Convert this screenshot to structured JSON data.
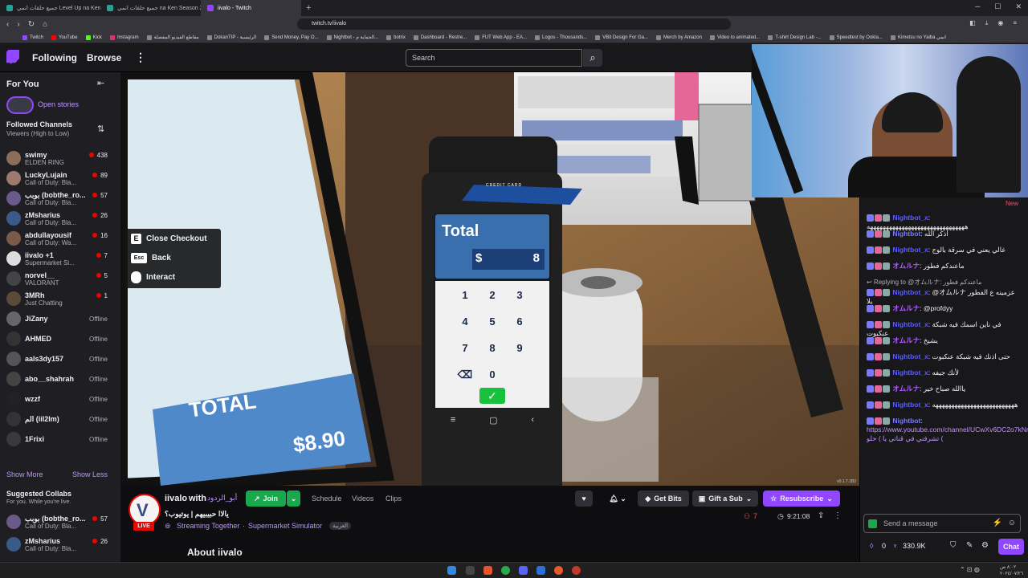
{
  "browser": {
    "tabs": [
      {
        "title": "جميع حلقات انمي Level Up na Ken",
        "color": "#2aa198"
      },
      {
        "title": "جميع حلقات انمي na Ken Season 2",
        "color": "#2aa198"
      },
      {
        "title": "iivalo - Twitch",
        "color": "#9147ff",
        "active": true
      }
    ],
    "url": "twitch.tv/iivalo",
    "bookmarks": [
      "Twitch",
      "YouTube",
      "Kick",
      "Instagram",
      "مقاطع الفيديو المفضلة",
      "DokanTIP - الرئيسية",
      "Send Money, Pay O...",
      "Nightbot - الحماية م...",
      "botrix",
      "Dashboard - Restre...",
      "FUT Web App - EA...",
      "Logos - Thousands...",
      "VBit Design For Ga...",
      "Merch by Amazon",
      "Video to animated...",
      "T-shirt Design Lab -...",
      "Speedtest by Ookla...",
      "Kimetsu no Yaiba انمي"
    ]
  },
  "topnav": {
    "following": "Following",
    "browse": "Browse",
    "search_placeholder": "Search"
  },
  "sidebar": {
    "for_you": "For You",
    "open_stories": "Open stories",
    "followed_title": "Followed Channels",
    "followed_sub": "Viewers (High to Low)",
    "channels": [
      {
        "name": "swimy",
        "game": "ELDEN RING",
        "viewers": "438",
        "live": true,
        "color": "#8a6d5a"
      },
      {
        "name": "LuckyLujain",
        "game": "Call of Duty: Bla...",
        "viewers": "89",
        "live": true,
        "color": "#9b7b6b"
      },
      {
        "name": "بوبب (bobthe_ro...",
        "game": "Call of Duty: Bla...",
        "viewers": "57",
        "live": true,
        "color": "#6a5a8a"
      },
      {
        "name": "zMsharius",
        "game": "Call of Duty: Bla...",
        "viewers": "26",
        "live": true,
        "color": "#3a5a8a"
      },
      {
        "name": "abdullayousif",
        "game": "Call of Duty: Wa...",
        "viewers": "16",
        "live": true,
        "color": "#7a5a4a"
      },
      {
        "name": "iivalo +1",
        "game": "Supermarket Si...",
        "viewers": "7",
        "live": true,
        "color": "#ddd"
      },
      {
        "name": "norvel__",
        "game": "VALORANT",
        "viewers": "5",
        "live": true,
        "color": "#444"
      },
      {
        "name": "3MRh",
        "game": "Just Chatting",
        "viewers": "1",
        "live": true,
        "color": "#5a4a3a"
      },
      {
        "name": "JiZany",
        "status": "Offline",
        "color": "#666"
      },
      {
        "name": "AHMED",
        "status": "Offline",
        "color": "#333"
      },
      {
        "name": "aals3dy157",
        "status": "Offline",
        "color": "#555"
      },
      {
        "name": "abo__shahrah",
        "status": "Offline",
        "color": "#444"
      },
      {
        "name": "wzzf",
        "status": "Offline",
        "color": "#222"
      },
      {
        "name": "الم (iil2lm)",
        "status": "Offline",
        "color": "#333"
      },
      {
        "name": "1Frixi",
        "status": "Offline",
        "color": "#3a3a3a"
      }
    ],
    "show_more": "Show More",
    "show_less": "Show Less",
    "suggested_title": "Suggested Collabs",
    "suggested_sub": "For you. While you're live.",
    "suggested": [
      {
        "name": "بوبب (bobthe_ro...",
        "game": "Call of Duty: Bla...",
        "viewers": "57",
        "color": "#6a5a8a"
      },
      {
        "name": "zMsharius",
        "game": "Call of Duty: Bla...",
        "viewers": "26",
        "color": "#3a5a8a"
      }
    ]
  },
  "game": {
    "prompts": [
      {
        "key": "E",
        "label": "Close Checkout"
      },
      {
        "key": "Esc",
        "label": "Back"
      },
      {
        "key": "",
        "label": "Interact"
      }
    ],
    "terminal_title": "Total",
    "terminal_currency": "$",
    "terminal_value": "8",
    "keypad": [
      "1",
      "2",
      "3",
      "4",
      "5",
      "6",
      "7",
      "8",
      "9",
      "⌫",
      "0",
      ""
    ],
    "card_label": "CREDIT CARD",
    "screen_total_label": "TOTAL",
    "screen_total_value": "$8.90",
    "version": "v0.1.7.1B2"
  },
  "stream": {
    "channel": "iivalo",
    "with_text": "with",
    "collab": "أبو_الردود",
    "title": "يالاا حبيبيهم | يوتيوب؟",
    "category_prefix": "Streaming Together",
    "category": "Supermarket Simulator",
    "language_tag": "العربية",
    "live_badge": "LIVE",
    "join": "Join",
    "tabs": [
      "Schedule",
      "Videos",
      "Clips"
    ],
    "get_bits": "Get Bits",
    "gift_sub": "Gift a Sub",
    "resubscribe": "Resubscribe",
    "viewers": "7",
    "uptime": "9:21:08",
    "about": "About iivalo"
  },
  "chat": {
    "new_label": "New",
    "messages": [
      {
        "user": "Nightbot_x",
        "text": "هههههههههههههههههههههههههههههههه",
        "ucolor": "#5c5cff"
      },
      {
        "user": "Nightbot",
        "text": "اذكر الله",
        "ucolor": "#7a7aff"
      },
      {
        "user": "Nightbot_x",
        "text": "غالي يعني في سرقة بالوج",
        "ucolor": "#5c5cff"
      },
      {
        "user": "オムルナ",
        "text": "ماعندكم فطور",
        "ucolor": "#b05cff"
      },
      {
        "user": "Nightbot_x",
        "text": "@オムルナ عزمينه ع الفطور يلا",
        "ucolor": "#5c5cff",
        "reply": "Replying to @オムルナ: ماعندكم فطور"
      },
      {
        "user": "オムルナ",
        "text": "@profdyy",
        "ucolor": "#b05cff"
      },
      {
        "user": "Nightbot_x",
        "text": "في ناين اسمك فيه شبكة عنكبوت",
        "ucolor": "#5c5cff"
      },
      {
        "user": "オムルナ",
        "text": "يشيخ",
        "ucolor": "#b05cff"
      },
      {
        "user": "Nightbot_x",
        "text": "حتى اذنك فيه شبكة عنكبوت",
        "ucolor": "#5c5cff"
      },
      {
        "user": "Nightbot_x",
        "text": "لأنك جيفه",
        "ucolor": "#5c5cff"
      },
      {
        "user": "オムルナ",
        "text": "ياالله صباح خير",
        "ucolor": "#b05cff"
      },
      {
        "user": "Nightbot_x",
        "text": "ههههههههههههههههههههههههههه",
        "ucolor": "#5c5cff"
      },
      {
        "user": "Nightbot",
        "text": "https://www.youtube.com/channel/UCwXv6DC2o7kNmGVxmNPhRJA تشرفني في قناتي يا ) حلو (",
        "ucolor": "#7a7aff"
      }
    ],
    "input_placeholder": "Send a message",
    "points": "0",
    "bits": "330.9K",
    "chat_button": "Chat"
  }
}
